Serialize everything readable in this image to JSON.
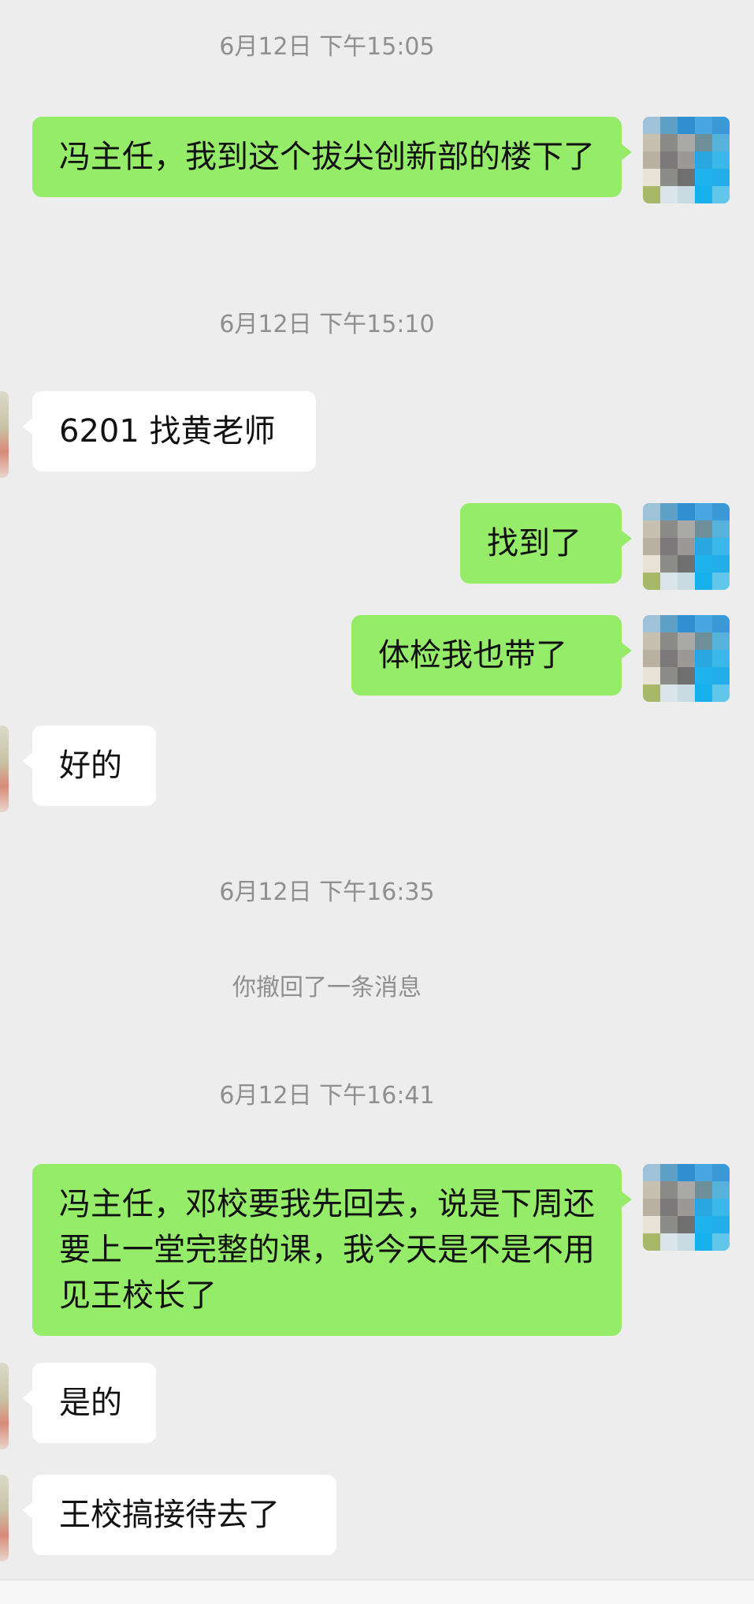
{
  "messages": {
    "ts1": "6月12日 下午15:05",
    "m1": "冯主任，我到这个拔尖创新部的楼下了",
    "ts2": "6月12日 下午15:10",
    "m2": "6201 找黄老师",
    "m3": "找到了",
    "m4": "体检我也带了",
    "m5": "好的",
    "ts3": "6月12日 下午16:35",
    "system1": "你撤回了一条消息",
    "ts4": "6月12日 下午16:41",
    "m6": "冯主任，邓校要我先回去，说是下周还要上一堂完整的课，我今天是不是不用见王校长了",
    "m7": "是的",
    "m8": "王校搞接待去了"
  },
  "colors": {
    "background": "#ededed",
    "outgoing_bubble": "#95ec69",
    "incoming_bubble": "#ffffff",
    "timestamp_text": "#8f8f8f"
  }
}
